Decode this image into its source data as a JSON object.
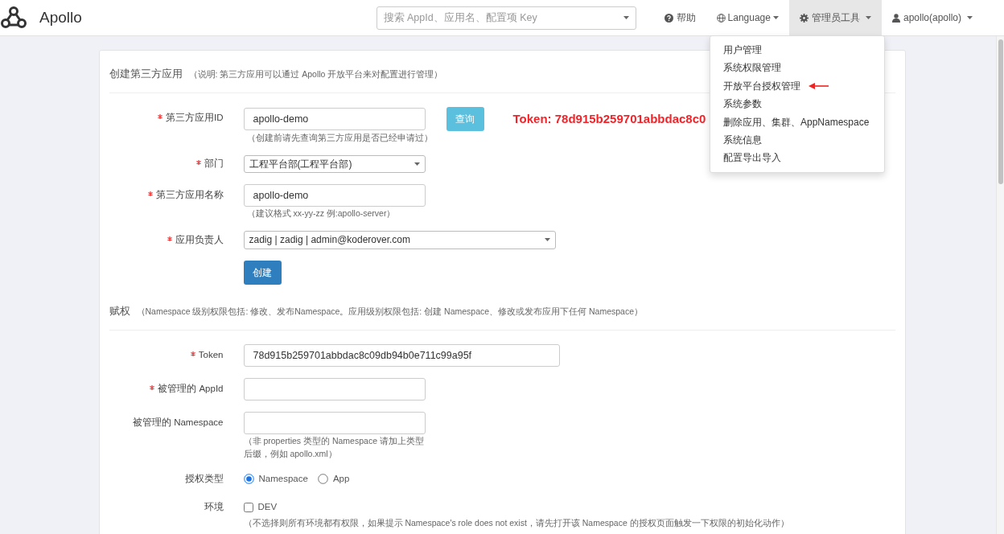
{
  "navbar": {
    "brand": "Apollo",
    "search": {
      "placeholder": "搜索 AppId、应用名、配置项 Key"
    },
    "links": [
      {
        "kind": "help",
        "label": "帮助",
        "active": false
      },
      {
        "kind": "language",
        "label": "Language",
        "active": false
      },
      {
        "kind": "admin",
        "label": "管理员工具",
        "active": true
      },
      {
        "kind": "user",
        "label": "apollo(apollo)",
        "active": false
      }
    ]
  },
  "admin_menu": {
    "items": [
      {
        "label": "用户管理",
        "pointed": false
      },
      {
        "label": "系统权限管理",
        "pointed": false
      },
      {
        "label": "开放平台授权管理",
        "pointed": true
      },
      {
        "label": "系统参数",
        "pointed": false
      },
      {
        "label": "删除应用、集群、AppNamespace",
        "pointed": false
      },
      {
        "label": "系统信息",
        "pointed": false
      },
      {
        "label": "配置导出导入",
        "pointed": false
      }
    ]
  },
  "create_section": {
    "title": "创建第三方应用",
    "note": "（说明: 第三方应用可以通过 Apollo 开放平台来对配置进行管理）",
    "fields": [
      {
        "kind": "input",
        "required": true,
        "label": "第三方应用ID",
        "value": "apollo-demo",
        "help": "（创建前请先查询第三方应用是否已经申请过）",
        "action": "查询",
        "result": "Token: 78d915b259701abbdac8c0"
      },
      {
        "kind": "select",
        "required": true,
        "label": "部门",
        "value": "工程平台部(工程平台部)"
      },
      {
        "kind": "input",
        "required": true,
        "label": "第三方应用名称",
        "value": "apollo-demo",
        "help": "（建议格式 xx-yy-zz 例:apollo-server）"
      },
      {
        "kind": "select",
        "required": true,
        "label": "应用负责人",
        "value": "zadig | zadig | admin@koderover.com",
        "wide": true
      }
    ],
    "submit": "创建"
  },
  "grant_section": {
    "title": "赋权",
    "note": "（Namespace 级别权限包括: 修改、发布Namespace。应用级别权限包括: 创建 Namespace、修改或发布应用下任何 Namespace）",
    "fields": [
      {
        "kind": "input",
        "required": true,
        "label": "Token",
        "value": "78d915b259701abbdac8c09db94b0e711c99a95f",
        "wide": true
      },
      {
        "kind": "input",
        "required": true,
        "label": "被管理的 AppId"
      },
      {
        "kind": "input",
        "required": false,
        "label": "被管理的 Namespace",
        "help": "（非 properties 类型的 Namespace 请加上类型后缀，例如 apollo.xml）"
      },
      {
        "kind": "radio",
        "required": false,
        "label": "授权类型",
        "options": [
          {
            "label": "Namespace",
            "selected": true
          },
          {
            "label": "App",
            "selected": false
          }
        ]
      },
      {
        "kind": "checkbox",
        "required": false,
        "label": "环境",
        "options": [
          {
            "label": "DEV",
            "checked": false
          }
        ],
        "help": "（不选择则所有环境都有权限，如果提示 Namespace's role does not exist，请先打开该 Namespace 的授权页面触发一下权限的初始化动作）"
      }
    ]
  }
}
